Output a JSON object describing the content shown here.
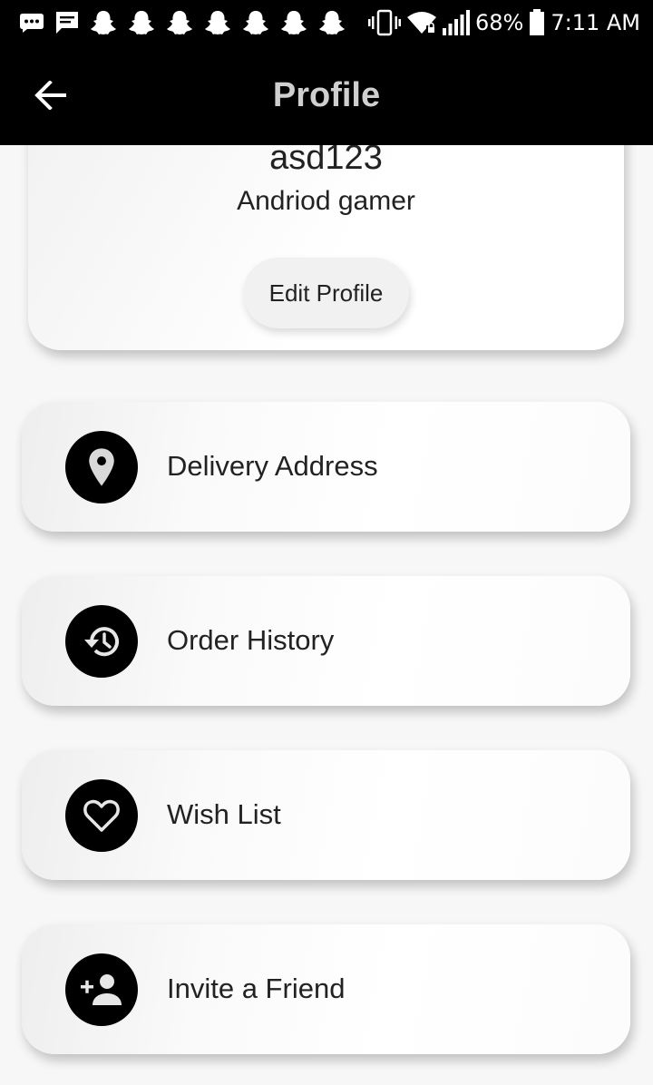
{
  "status_bar": {
    "battery": "68%",
    "time": "7:11 AM",
    "left_icons": [
      "message-icon",
      "chat-icon",
      "snapchat-icon",
      "snapchat-icon",
      "snapchat-icon",
      "snapchat-icon",
      "snapchat-icon",
      "snapchat-icon",
      "snapchat-icon"
    ],
    "right_icons": [
      "vibrate-icon",
      "wifi-icon",
      "signal-icon",
      "battery-icon"
    ]
  },
  "app_bar": {
    "title": "Profile",
    "back_icon": "arrow-back-icon",
    "title_color": "#cfcfcf",
    "background": "#000000"
  },
  "profile": {
    "username": "asd123",
    "bio": "Andriod gamer",
    "edit_button_label": "Edit Profile"
  },
  "menu": {
    "items": [
      {
        "label": "Delivery Address",
        "icon": "location-pin-icon"
      },
      {
        "label": "Order History",
        "icon": "history-icon"
      },
      {
        "label": "Wish List",
        "icon": "heart-icon"
      },
      {
        "label": "Invite a Friend",
        "icon": "person-add-icon"
      }
    ]
  }
}
